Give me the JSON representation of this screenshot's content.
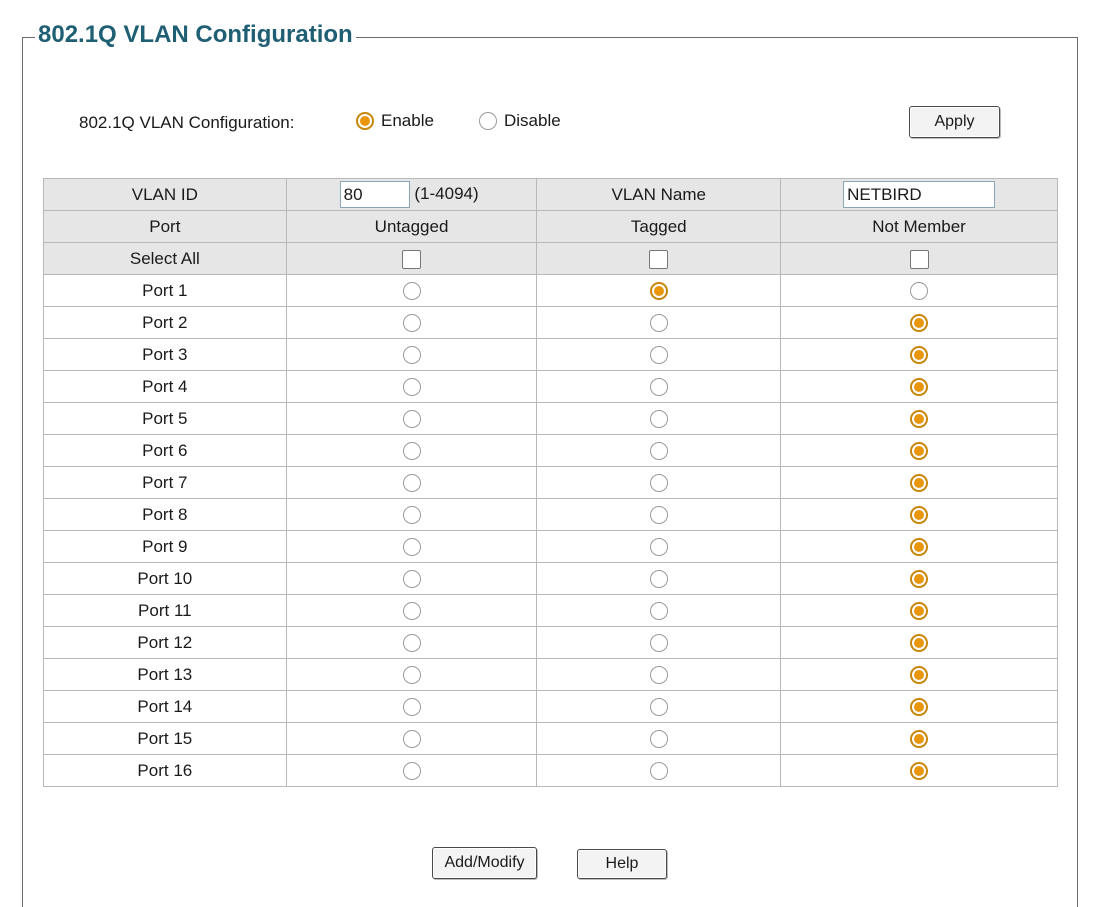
{
  "panel": {
    "legend": "802.1Q VLAN Configuration",
    "config_label": "802.1Q VLAN Configuration:",
    "enable_label": "Enable",
    "disable_label": "Disable",
    "enabled": true,
    "apply_label": "Apply"
  },
  "table": {
    "vlan_id_label": "VLAN ID",
    "vlan_id_value": "80",
    "vlan_id_range": "(1-4094)",
    "vlan_name_label": "VLAN Name",
    "vlan_name_value": "NETBIRD",
    "headers": [
      "Port",
      "Untagged",
      "Tagged",
      "Not Member"
    ],
    "select_all_label": "Select All",
    "ports": [
      {
        "name": "Port 1",
        "mode": "Tagged"
      },
      {
        "name": "Port 2",
        "mode": "Not Member"
      },
      {
        "name": "Port 3",
        "mode": "Not Member"
      },
      {
        "name": "Port 4",
        "mode": "Not Member"
      },
      {
        "name": "Port 5",
        "mode": "Not Member"
      },
      {
        "name": "Port 6",
        "mode": "Not Member"
      },
      {
        "name": "Port 7",
        "mode": "Not Member"
      },
      {
        "name": "Port 8",
        "mode": "Not Member"
      },
      {
        "name": "Port 9",
        "mode": "Not Member"
      },
      {
        "name": "Port 10",
        "mode": "Not Member"
      },
      {
        "name": "Port 11",
        "mode": "Not Member"
      },
      {
        "name": "Port 12",
        "mode": "Not Member"
      },
      {
        "name": "Port 13",
        "mode": "Not Member"
      },
      {
        "name": "Port 14",
        "mode": "Not Member"
      },
      {
        "name": "Port 15",
        "mode": "Not Member"
      },
      {
        "name": "Port 16",
        "mode": "Not Member"
      }
    ]
  },
  "footer": {
    "add_modify_label": "Add/Modify",
    "help_label": "Help"
  },
  "colors": {
    "legend": "#1f5f74",
    "radio_checked": "#e9960d",
    "header_bg": "#e6e6e6"
  }
}
